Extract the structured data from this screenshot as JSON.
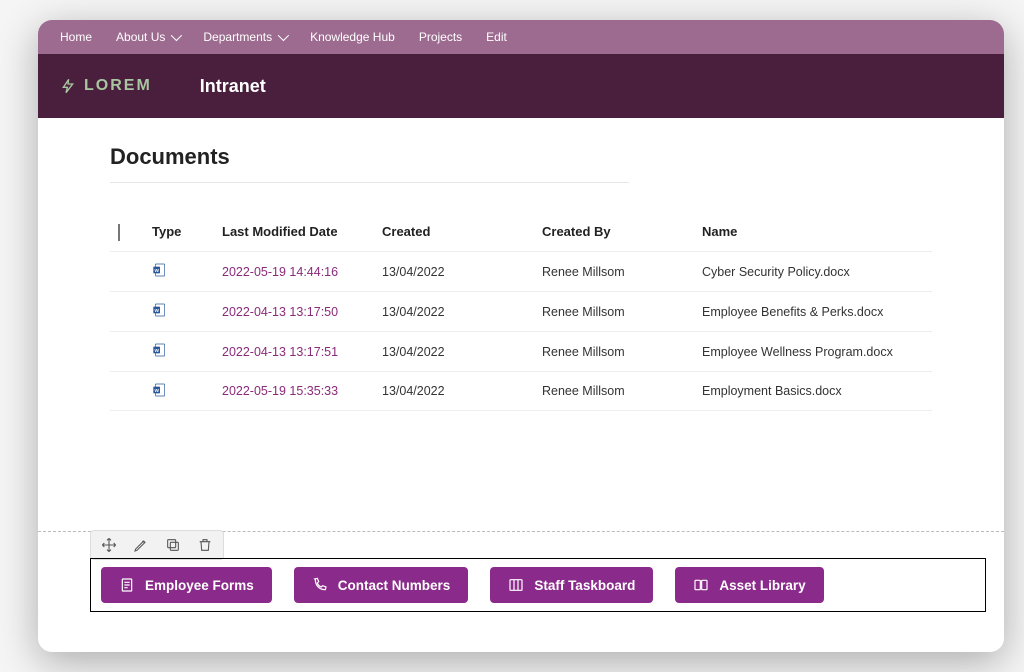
{
  "topnav": {
    "items": [
      {
        "label": "Home",
        "dropdown": false
      },
      {
        "label": "About Us",
        "dropdown": true
      },
      {
        "label": "Departments",
        "dropdown": true
      },
      {
        "label": "Knowledge Hub",
        "dropdown": false
      },
      {
        "label": "Projects",
        "dropdown": false
      },
      {
        "label": "Edit",
        "dropdown": false
      }
    ]
  },
  "brand": {
    "logo_text": "LOREM",
    "site_title": "Intranet"
  },
  "page": {
    "title": "Documents"
  },
  "table": {
    "headers": {
      "type": "Type",
      "modified": "Last Modified Date",
      "created": "Created",
      "created_by": "Created By",
      "name": "Name"
    },
    "rows": [
      {
        "modified": "2022-05-19 14:44:16",
        "created": "13/04/2022",
        "created_by": "Renee Millsom",
        "name": "Cyber Security Policy.docx"
      },
      {
        "modified": "2022-04-13 13:17:50",
        "created": "13/04/2022",
        "created_by": "Renee Millsom",
        "name": "Employee Benefits & Perks.docx"
      },
      {
        "modified": "2022-04-13 13:17:51",
        "created": "13/04/2022",
        "created_by": "Renee Millsom",
        "name": "Employee Wellness Program.docx"
      },
      {
        "modified": "2022-05-19 15:35:33",
        "created": "13/04/2022",
        "created_by": "Renee Millsom",
        "name": "Employment Basics.docx"
      }
    ]
  },
  "quicklinks": [
    {
      "label": "Employee Forms"
    },
    {
      "label": "Contact Numbers"
    },
    {
      "label": "Staff Taskboard"
    },
    {
      "label": "Asset Library"
    }
  ],
  "colors": {
    "accent": "#8a2a8a",
    "brandbar": "#4a1f3d",
    "topnav": "#9c6b8f"
  }
}
